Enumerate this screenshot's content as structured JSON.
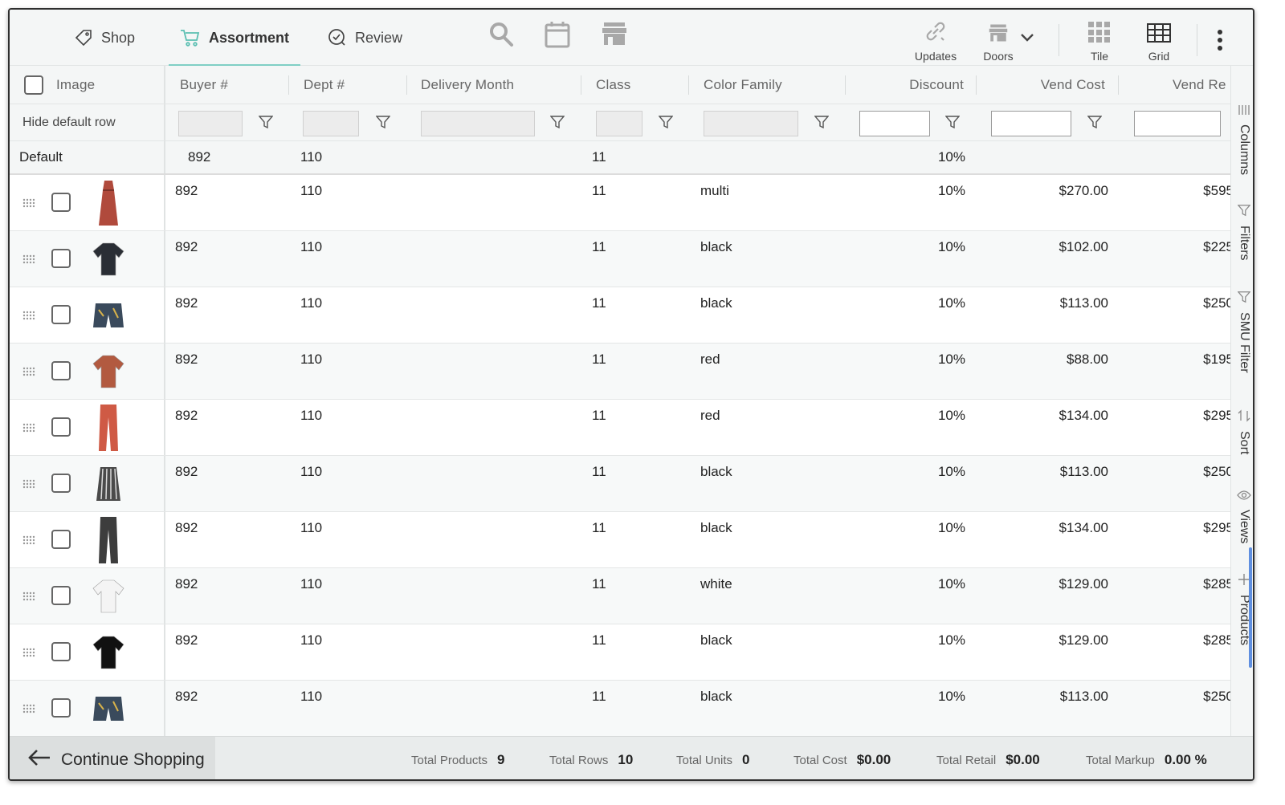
{
  "toolbar": {
    "tabs": [
      {
        "label": "Shop",
        "icon": "tag-icon"
      },
      {
        "label": "Assortment",
        "icon": "cart-icon",
        "active": true
      },
      {
        "label": "Review",
        "icon": "check-circle-icon"
      }
    ],
    "buttons": {
      "updates": "Updates",
      "doors": "Doors",
      "tile": "Tile",
      "grid": "Grid"
    },
    "accent_color": "#7fcfc4"
  },
  "grid": {
    "columns": {
      "image": "Image",
      "buyer": "Buyer #",
      "dept": "Dept #",
      "delivery": "Delivery Month",
      "class": "Class",
      "color_family": "Color Family",
      "discount": "Discount",
      "vend_cost": "Vend Cost",
      "vend_retail": "Vend Re"
    },
    "filter_row_label": "Hide default row",
    "default_row": {
      "label": "Default",
      "buyer": "892",
      "dept": "110",
      "class": "11",
      "discount": "10%"
    },
    "rows": [
      {
        "buyer": "892",
        "dept": "110",
        "class": "11",
        "color": "multi",
        "discount": "10%",
        "cost": "$270.00",
        "retail": "$595"
      },
      {
        "buyer": "892",
        "dept": "110",
        "class": "11",
        "color": "black",
        "discount": "10%",
        "cost": "$102.00",
        "retail": "$225"
      },
      {
        "buyer": "892",
        "dept": "110",
        "class": "11",
        "color": "black",
        "discount": "10%",
        "cost": "$113.00",
        "retail": "$250"
      },
      {
        "buyer": "892",
        "dept": "110",
        "class": "11",
        "color": "red",
        "discount": "10%",
        "cost": "$88.00",
        "retail": "$195"
      },
      {
        "buyer": "892",
        "dept": "110",
        "class": "11",
        "color": "red",
        "discount": "10%",
        "cost": "$134.00",
        "retail": "$295"
      },
      {
        "buyer": "892",
        "dept": "110",
        "class": "11",
        "color": "black",
        "discount": "10%",
        "cost": "$113.00",
        "retail": "$250"
      },
      {
        "buyer": "892",
        "dept": "110",
        "class": "11",
        "color": "black",
        "discount": "10%",
        "cost": "$134.00",
        "retail": "$295"
      },
      {
        "buyer": "892",
        "dept": "110",
        "class": "11",
        "color": "white",
        "discount": "10%",
        "cost": "$129.00",
        "retail": "$285"
      },
      {
        "buyer": "892",
        "dept": "110",
        "class": "11",
        "color": "black",
        "discount": "10%",
        "cost": "$129.00",
        "retail": "$285"
      },
      {
        "buyer": "892",
        "dept": "110",
        "class": "11",
        "color": "black",
        "discount": "10%",
        "cost": "$113.00",
        "retail": "$250"
      }
    ]
  },
  "side_panel": {
    "tabs": [
      "Columns",
      "Filters",
      "SMU Filter",
      "Sort",
      "Views",
      "Products"
    ]
  },
  "footer": {
    "continue_label": "Continue Shopping",
    "stats": [
      {
        "label": "Total Products",
        "value": "9"
      },
      {
        "label": "Total Rows",
        "value": "10"
      },
      {
        "label": "Total Units",
        "value": "0"
      },
      {
        "label": "Total Cost",
        "value": "$0.00"
      },
      {
        "label": "Total Retail",
        "value": "$0.00"
      },
      {
        "label": "Total Markup",
        "value": "0.00 %"
      }
    ]
  }
}
